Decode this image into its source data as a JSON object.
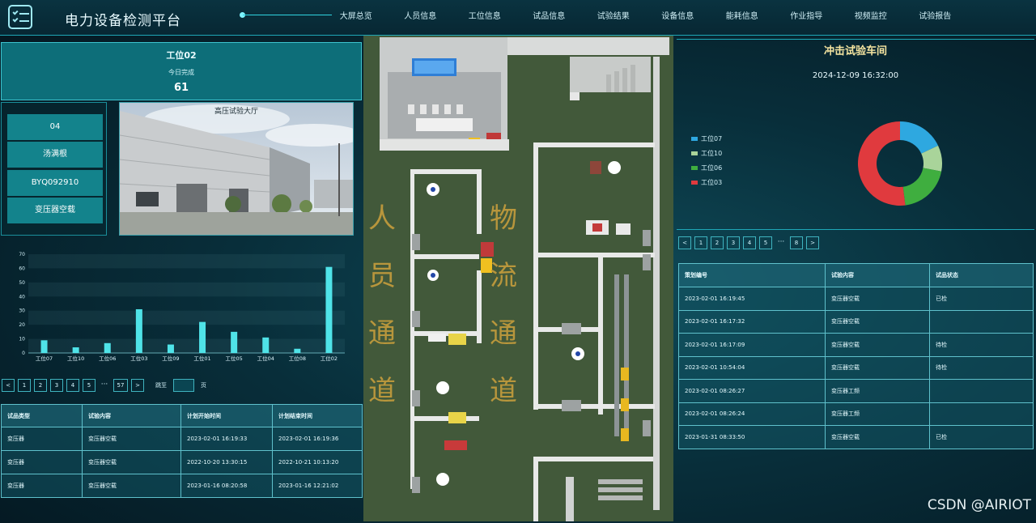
{
  "header": {
    "title": "电力设备检测平台",
    "nav": [
      "大屏总览",
      "人员信息",
      "工位信息",
      "试品信息",
      "试验结果",
      "设备信息",
      "能耗信息",
      "作业指导",
      "视频监控",
      "试验报告"
    ]
  },
  "station": {
    "name": "工位02",
    "subtitle": "今日完成",
    "count": "61"
  },
  "info": [
    "04",
    "汤满根",
    "BYQ092910",
    "变压器空载"
  ],
  "photo": {
    "caption": "高压试验大厅"
  },
  "chart_data": {
    "type": "bar",
    "categories": [
      "工位07",
      "工位10",
      "工位06",
      "工位03",
      "工位09",
      "工位01",
      "工位05",
      "工位04",
      "工位08",
      "工位02"
    ],
    "values": [
      9,
      4,
      7,
      31,
      6,
      22,
      15,
      11,
      3,
      61
    ],
    "ylim": [
      0,
      70
    ],
    "yticks": [
      "0",
      "10",
      "20",
      "30",
      "40",
      "50",
      "60",
      "70"
    ],
    "bar_color": "#4fe3e8"
  },
  "left_pager": {
    "pages": [
      "1",
      "2",
      "3",
      "4",
      "5"
    ],
    "dots": "···",
    "last": "57",
    "prev": "<",
    "next": ">",
    "goto_label": "跳至",
    "page_label": "页"
  },
  "left_table": {
    "headers": [
      "试品类型",
      "试验内容",
      "计划开始时间",
      "计划结束时间"
    ],
    "rows": [
      [
        "变压器",
        "变压器空载",
        "2023-02-01 16:19:33",
        "2023-02-01 16:19:36"
      ],
      [
        "变压器",
        "变压器空载",
        "2022-10-20 13:30:15",
        "2022-10-21 10:13:20"
      ],
      [
        "变压器",
        "变压器空载",
        "2023-01-16 08:20:58",
        "2023-01-16 12:21:02"
      ]
    ]
  },
  "map": {
    "labels": [
      "人",
      "员",
      "通",
      "道",
      "物",
      "流",
      "通",
      "道"
    ]
  },
  "right": {
    "title": "冲击试验车间",
    "time": "2024-12-09 16:32:00",
    "donut": {
      "legend": [
        "工位07",
        "工位10",
        "工位06",
        "工位03"
      ],
      "values": [
        18,
        10,
        20,
        52
      ],
      "colors": [
        "#2ea8e0",
        "#a9d49a",
        "#3fae3f",
        "#e03a3e"
      ]
    },
    "pager": {
      "pages": [
        "1",
        "2",
        "3",
        "4",
        "5"
      ],
      "dots": "···",
      "last": "8",
      "prev": "<",
      "next": ">"
    },
    "table": {
      "headers": [
        "策划编号",
        "试验内容",
        "试品状态"
      ],
      "rows": [
        [
          "2023-02-01 16:19:45",
          "变压器空载",
          "已检"
        ],
        [
          "2023-02-01 16:17:32",
          "变压器空载",
          ""
        ],
        [
          "2023-02-01 16:17:09",
          "变压器空载",
          "待检"
        ],
        [
          "2023-02-01 10:54:04",
          "变压器空载",
          "待检"
        ],
        [
          "2023-02-01 08:26:27",
          "变压器工频",
          ""
        ],
        [
          "2023-02-01 08:26:24",
          "变压器工频",
          ""
        ],
        [
          "2023-01-31 08:33:50",
          "变压器空载",
          "已检"
        ]
      ]
    }
  },
  "watermark": "CSDN @AIRIOT"
}
